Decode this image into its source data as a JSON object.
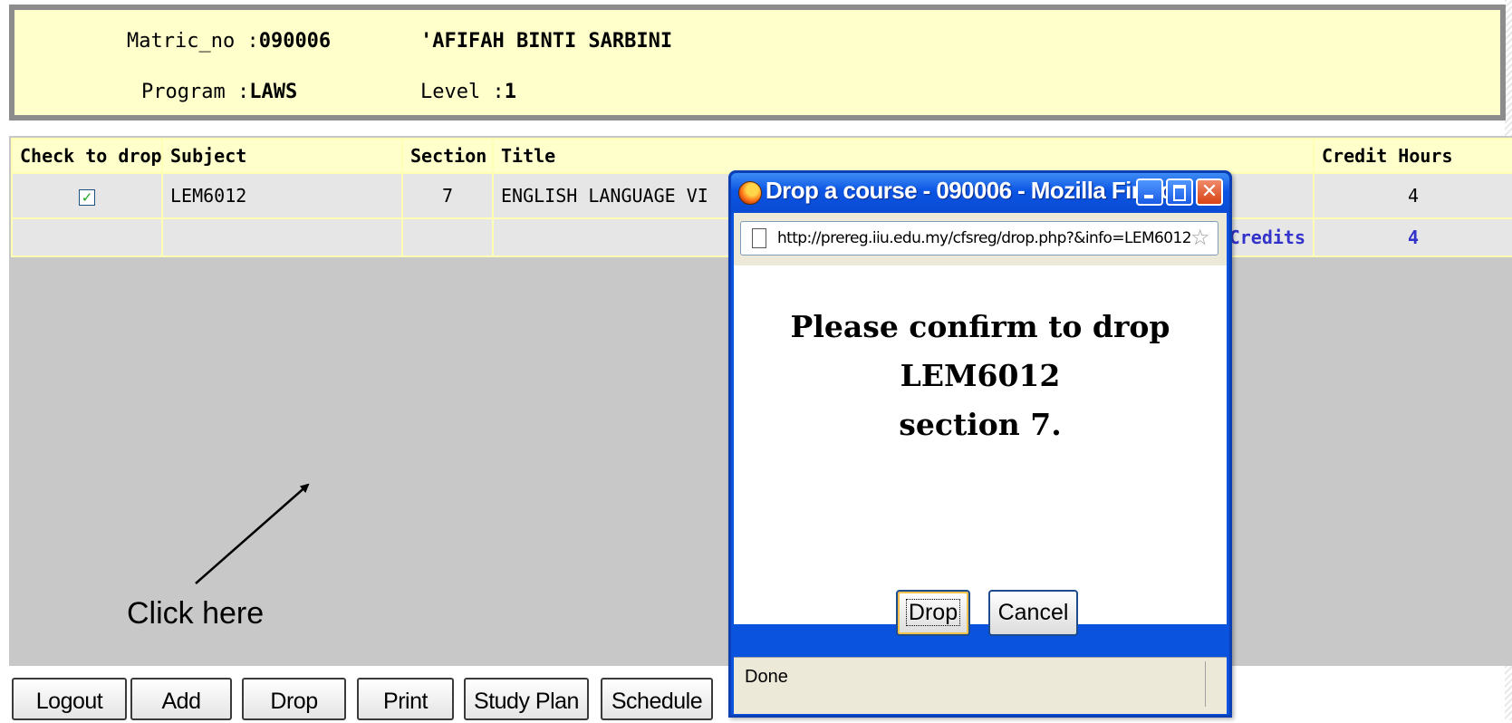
{
  "student": {
    "matric_label": "Matric_no :",
    "matric_no": "090006",
    "name": "'AFIFAH BINTI SARBINI",
    "program_label": "Program :",
    "program": "LAWS",
    "level_label": "Level :",
    "level": "1"
  },
  "table": {
    "headers": [
      "Check to drop",
      "Subject",
      "Section",
      "Title",
      "Credit Hours"
    ],
    "rows": [
      {
        "checked": true,
        "subject": "LEM6012",
        "section": "7",
        "title": "ENGLISH LANGUAGE VI",
        "credit_hours": "4"
      }
    ],
    "total_label": "Credits",
    "total_credits": "4"
  },
  "buttons": [
    "Logout",
    "Add",
    "Drop",
    "Print",
    "Study Plan",
    "Schedule"
  ],
  "annotation": {
    "text": "Click here"
  },
  "popup": {
    "title": "Drop a course - 090006 - Mozilla Firefox",
    "url": "http://prereg.iiu.edu.my/cfsreg/drop.php?&info=LEM6012",
    "message_lines": [
      "Please confirm to drop",
      "LEM6012",
      "section 7."
    ],
    "confirm_label": "Drop",
    "cancel_label": "Cancel",
    "status": "Done"
  },
  "icons": {
    "checkbox": "checkbox-checked-icon",
    "browser": "firefox-icon",
    "page": "page-icon",
    "bookmark": "star-icon",
    "window_controls": [
      "minimize-icon",
      "maximize-icon",
      "close-icon"
    ]
  },
  "colors": {
    "info_panel_bg": "#ffffcc",
    "table_row_bg": "#e6e6e6",
    "content_bg": "#c8c8c8",
    "credits_text": "#3333cc",
    "titlebar": "#0a53de"
  }
}
